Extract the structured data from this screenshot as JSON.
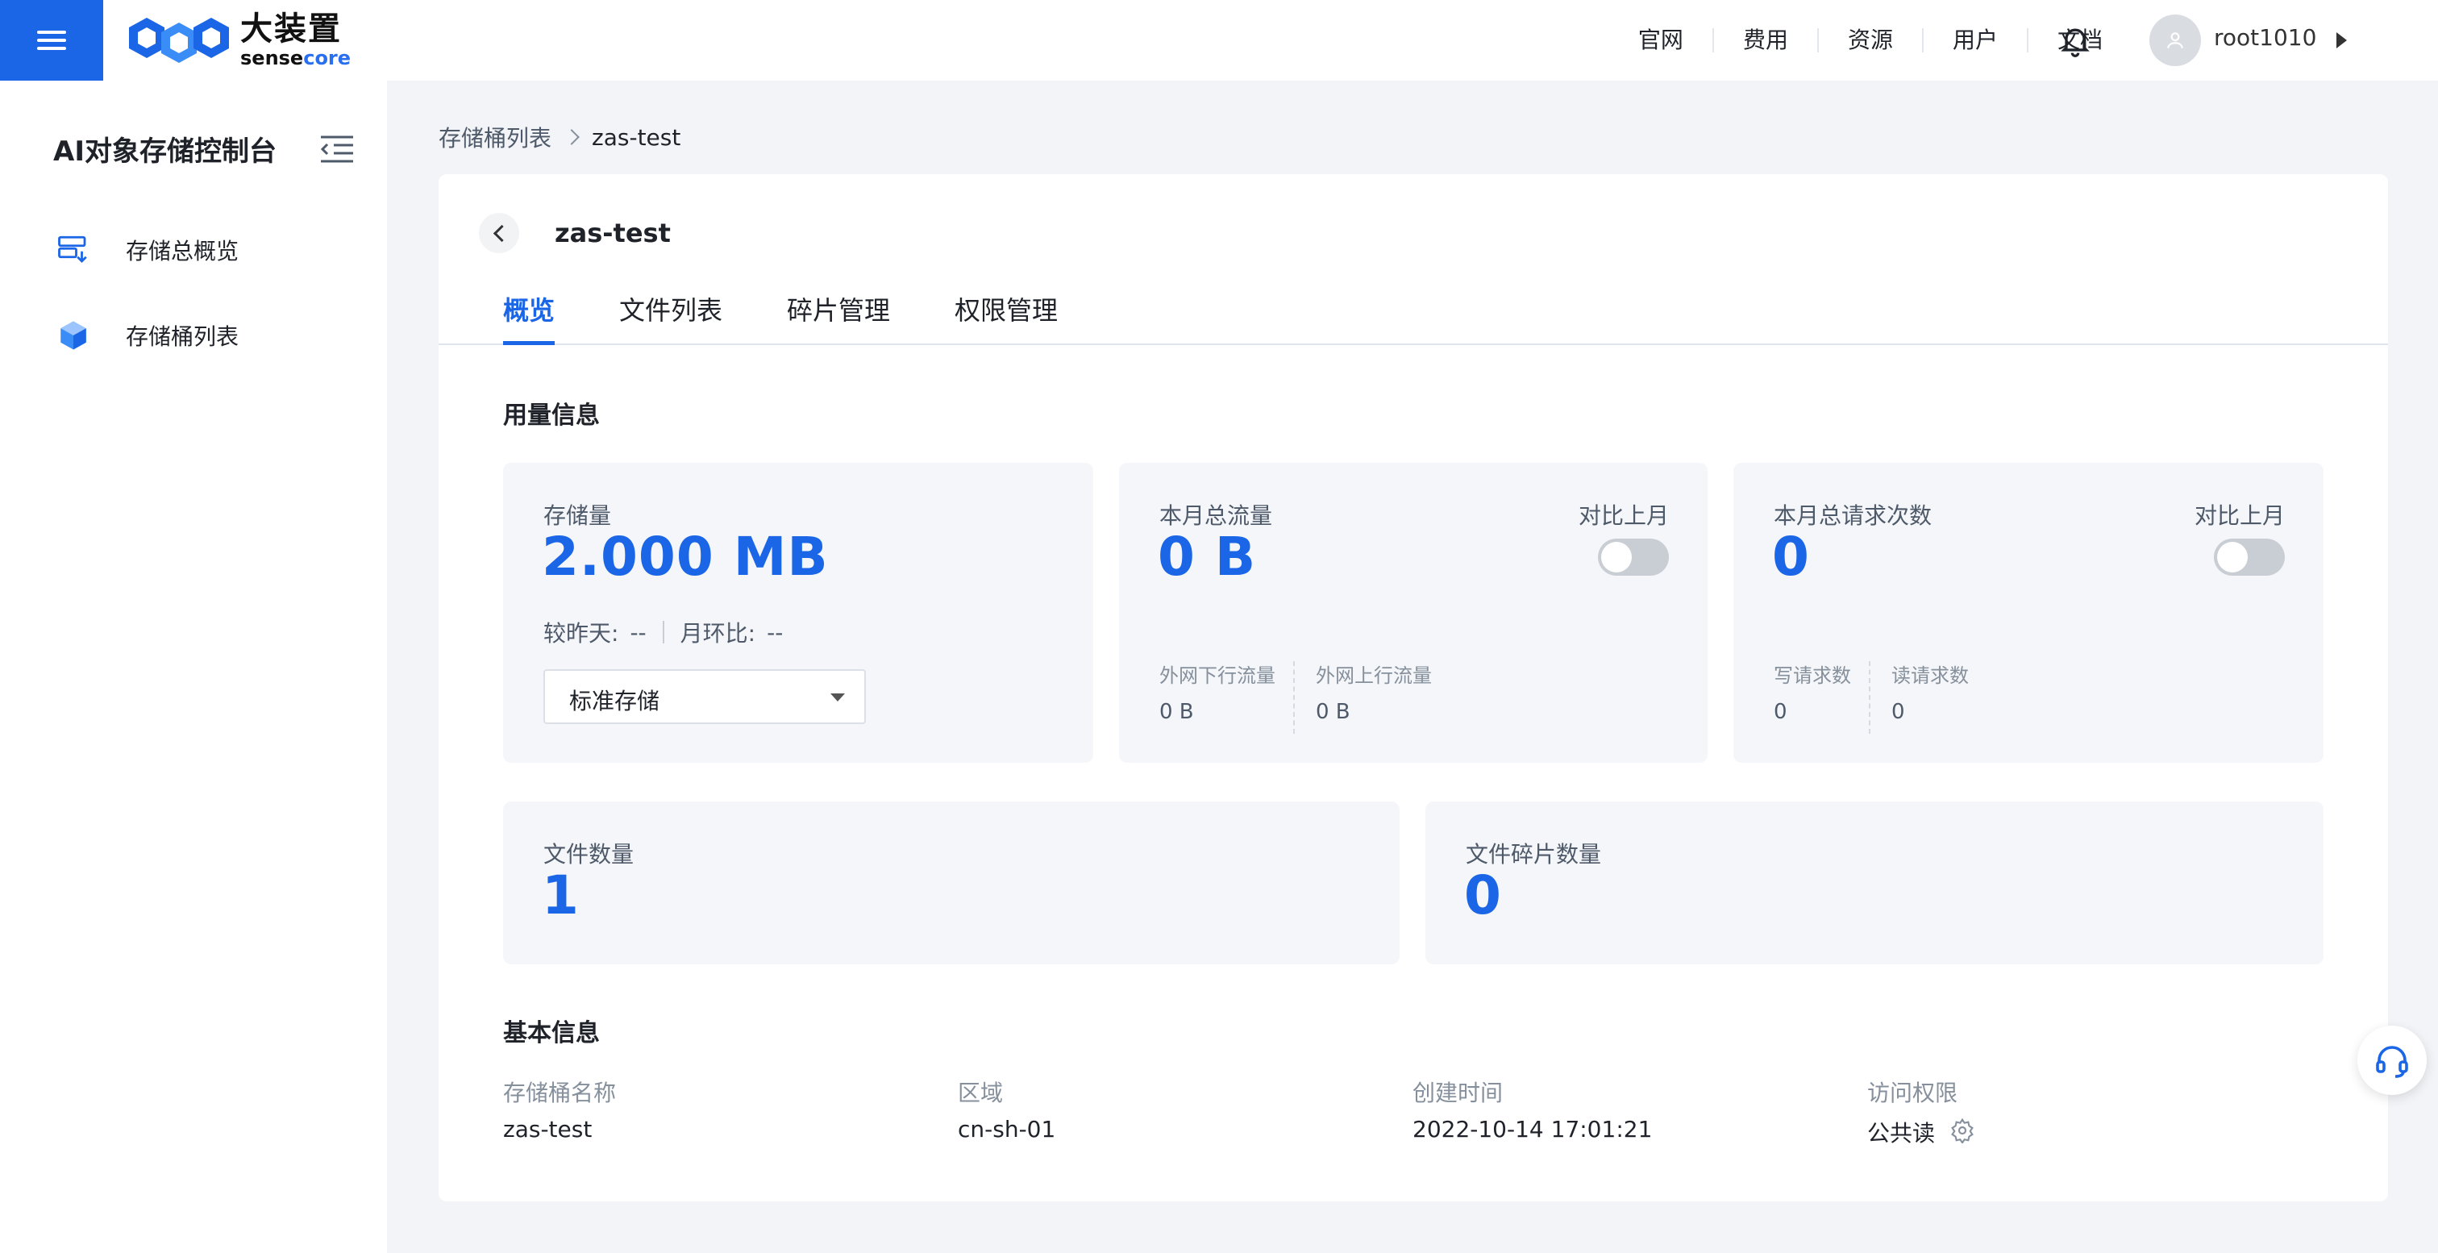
{
  "header": {
    "logo_cn": "大装置",
    "logo_en_prefix": "sense",
    "logo_en_suffix": "core",
    "nav": [
      "官网",
      "费用",
      "资源",
      "用户",
      "文档"
    ],
    "username": "root1010"
  },
  "sidebar": {
    "title": "AI对象存储控制台",
    "items": [
      {
        "label": "存储总概览",
        "icon": "storage-overview-icon"
      },
      {
        "label": "存储桶列表",
        "icon": "bucket-cube-icon"
      }
    ]
  },
  "breadcrumb": {
    "parent": "存储桶列表",
    "current": "zas-test"
  },
  "bucket": {
    "title": "zas-test",
    "tabs": [
      "概览",
      "文件列表",
      "碎片管理",
      "权限管理"
    ],
    "active_tab": "概览"
  },
  "usage": {
    "section_title": "用量信息",
    "storage": {
      "label": "存储量",
      "value": "2.000 MB",
      "day_label": "较昨天:",
      "day_value": "--",
      "month_label": "月环比:",
      "month_value": "--",
      "storage_class": "标准存储"
    },
    "traffic": {
      "label": "本月总流量",
      "value": "0 B",
      "compare_label": "对比上月",
      "compare_on": false,
      "down_label": "外网下行流量",
      "down_value": "0 B",
      "up_label": "外网上行流量",
      "up_value": "0 B"
    },
    "requests": {
      "label": "本月总请求次数",
      "value": "0",
      "compare_label": "对比上月",
      "compare_on": false,
      "write_label": "写请求数",
      "write_value": "0",
      "read_label": "读请求数",
      "read_value": "0"
    },
    "files": {
      "label": "文件数量",
      "value": "1"
    },
    "fragments": {
      "label": "文件碎片数量",
      "value": "0"
    }
  },
  "basic": {
    "section_title": "基本信息",
    "name_label": "存储桶名称",
    "name_value": "zas-test",
    "region_label": "区域",
    "region_value": "cn-sh-01",
    "created_label": "创建时间",
    "created_value": "2022-10-14 17:01:21",
    "access_label": "访问权限",
    "access_value": "公共读"
  },
  "colors": {
    "primary": "#1b66e6",
    "background": "#f2f4f8",
    "card": "#ffffff"
  }
}
